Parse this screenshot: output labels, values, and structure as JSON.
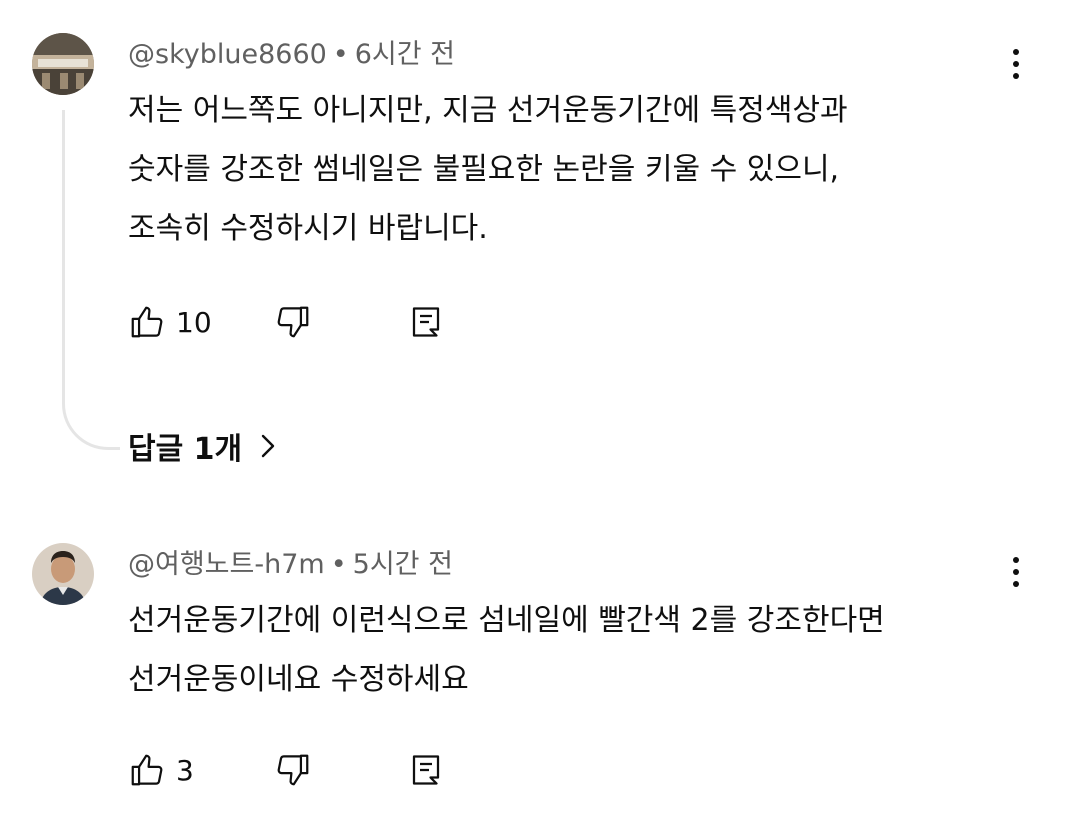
{
  "comments": [
    {
      "author": "@skyblue8660",
      "time": "6시간 전",
      "lines": [
        "저는 어느쪽도 아니지만, 지금 선거운동기간에 특정색상과",
        "숫자를 강조한 썸네일은 불필요한 논란을 키울 수 있으니,",
        "조속히 수정하시기 바랍니다."
      ],
      "likes": "10",
      "replies_label": "답글 1개",
      "avatar_colors": {
        "top": "#7b6a58",
        "mid": "#b7a48a",
        "bottom": "#4e453c"
      }
    },
    {
      "author": "@여행노트-h7m",
      "time": "5시간 전",
      "lines": [
        "선거운동기간에 이런식으로  섬네일에 빨간색 2를 강조한다면",
        "선거운동이네요 수정하세요"
      ],
      "likes": "3",
      "avatar_colors": {
        "bg": "#d9cfc3",
        "face": "#c89a78",
        "shirt": "#2c3848"
      }
    }
  ],
  "separator": "•",
  "icons": [
    "like-icon",
    "dislike-icon",
    "reply-icon",
    "more-icon",
    "chevron-right-icon"
  ]
}
